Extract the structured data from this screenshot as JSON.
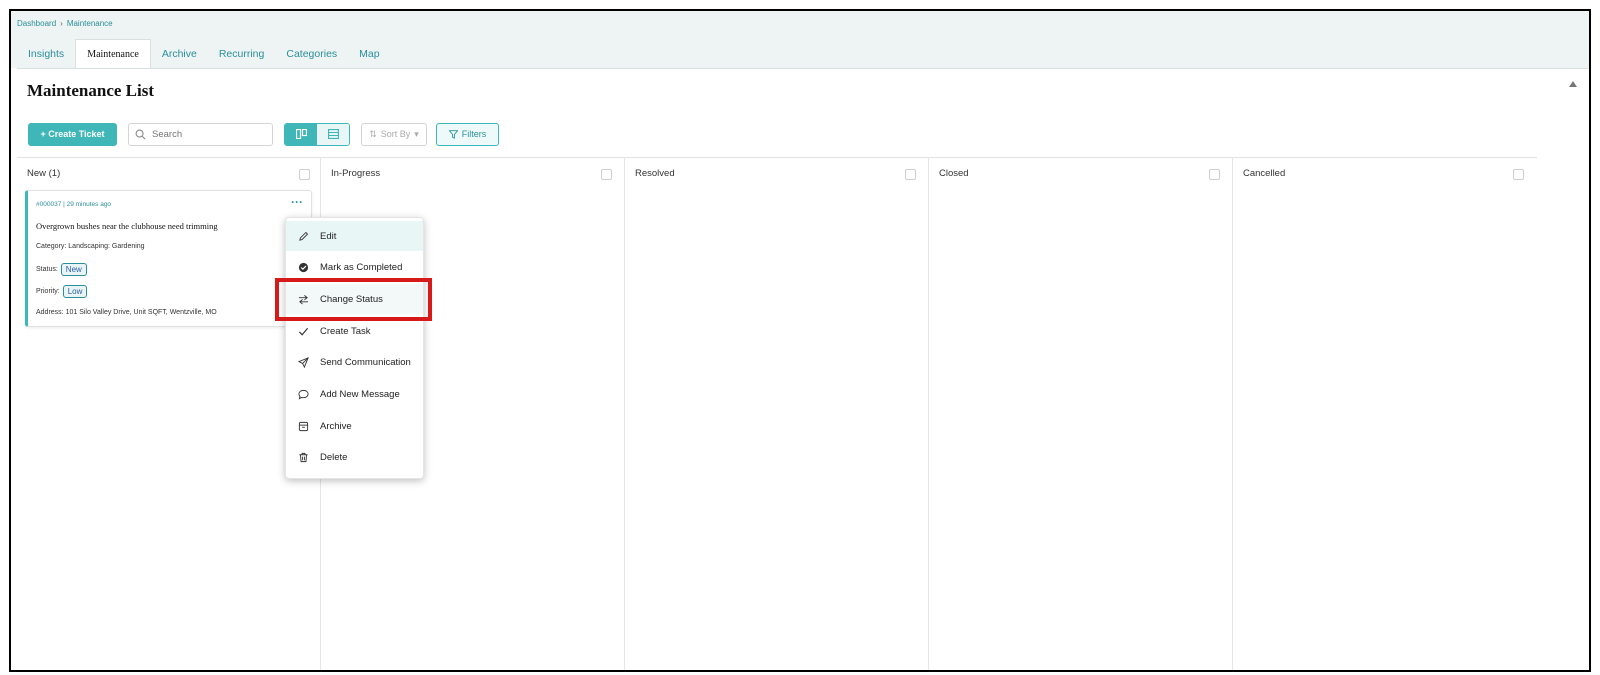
{
  "breadcrumb": {
    "items": [
      "Dashboard",
      "Maintenance"
    ],
    "separator": "›"
  },
  "tabs": [
    {
      "label": "Insights",
      "active": false
    },
    {
      "label": "Maintenance",
      "active": true
    },
    {
      "label": "Archive",
      "active": false
    },
    {
      "label": "Recurring",
      "active": false
    },
    {
      "label": "Categories",
      "active": false
    },
    {
      "label": "Map",
      "active": false
    }
  ],
  "page_title": "Maintenance List",
  "toolbar": {
    "create_label": "+ Create Ticket",
    "search_placeholder": "Search",
    "sort_label": "Sort By",
    "filters_label": "Filters"
  },
  "columns": [
    {
      "label": "New (1)"
    },
    {
      "label": "In-Progress"
    },
    {
      "label": "Resolved"
    },
    {
      "label": "Closed"
    },
    {
      "label": "Cancelled"
    }
  ],
  "card": {
    "meta": "#000037 | 29 minutes ago",
    "title": "Overgrown bushes near the clubhouse need trimming",
    "category": "Category: Landscaping: Gardening",
    "status_label": "Status:",
    "status_value": "New",
    "priority_label": "Priority:",
    "priority_value": "Low",
    "address": "Address: 101 Silo Valley Drive, Unit SQFT, Wentzville, MO"
  },
  "menu": {
    "items": [
      {
        "label": "Edit",
        "icon": "pencil-icon"
      },
      {
        "label": "Mark as Completed",
        "icon": "check-circle-icon"
      },
      {
        "label": "Change Status",
        "icon": "swap-arrows-icon"
      },
      {
        "label": "Create Task",
        "icon": "checkmark-icon"
      },
      {
        "label": "Send Communication",
        "icon": "send-icon"
      },
      {
        "label": "Add New Message",
        "icon": "message-bubble-icon"
      },
      {
        "label": "Archive",
        "icon": "archive-box-icon"
      },
      {
        "label": "Delete",
        "icon": "trash-icon"
      }
    ]
  },
  "colors": {
    "accent": "#3fb6b8",
    "link": "#2b8f9a",
    "highlight_box": "#d61a1a"
  }
}
